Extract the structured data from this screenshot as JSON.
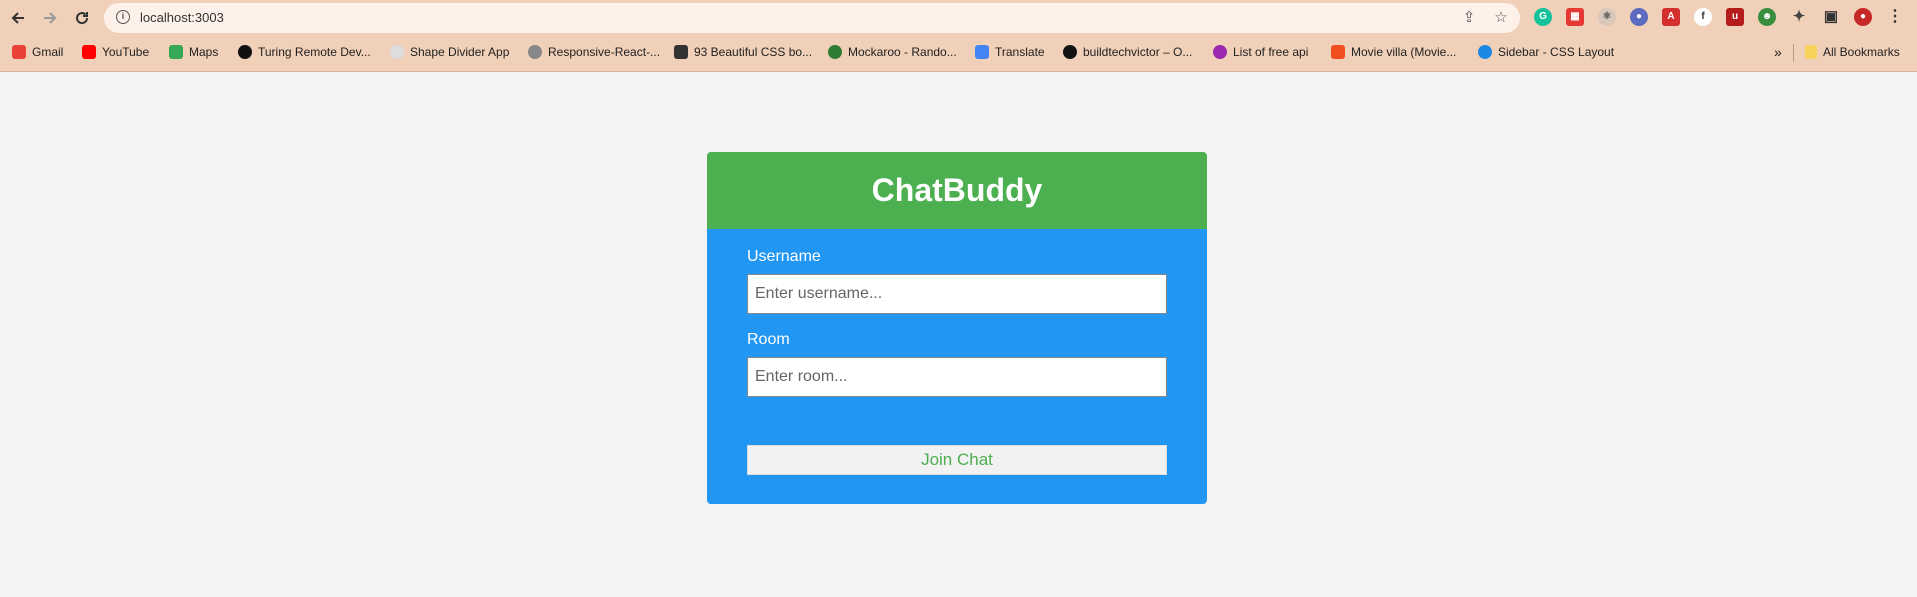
{
  "browser": {
    "url": "localhost:3003",
    "bookmarks": [
      {
        "label": "Gmail",
        "icon": "gmail-icon",
        "color": "#ea4335"
      },
      {
        "label": "YouTube",
        "icon": "youtube-icon",
        "color": "#ff0000"
      },
      {
        "label": "Maps",
        "icon": "maps-icon",
        "color": "#34a853"
      },
      {
        "label": "Turing Remote Dev...",
        "icon": "turing-icon",
        "color": "#111111"
      },
      {
        "label": "Shape Divider App",
        "icon": "shape-divider-icon",
        "color": "#dddddd"
      },
      {
        "label": "Responsive-React-...",
        "icon": "github-icon",
        "color": "#777777"
      },
      {
        "label": "93 Beautiful CSS bo...",
        "icon": "css-box-icon",
        "color": "#333333"
      },
      {
        "label": "Mockaroo - Rando...",
        "icon": "mockaroo-icon",
        "color": "#2e7d32"
      },
      {
        "label": "Translate",
        "icon": "translate-icon",
        "color": "#4285f4"
      },
      {
        "label": "buildtechvictor – O...",
        "icon": "buildtech-icon",
        "color": "#111111"
      },
      {
        "label": "List of free api",
        "icon": "api-list-icon",
        "color": "#9c27b0"
      },
      {
        "label": "Movie villa (Movie...",
        "icon": "figma-icon",
        "color": "#f24e1e"
      },
      {
        "label": "Sidebar - CSS Layout",
        "icon": "sidebar-layout-icon",
        "color": "#1e88e5"
      }
    ],
    "all_bookmarks_label": "All Bookmarks",
    "overflow_label": "»"
  },
  "app": {
    "title": "ChatBuddy",
    "username_label": "Username",
    "username_placeholder": "Enter username...",
    "room_label": "Room",
    "room_placeholder": "Enter room...",
    "join_label": "Join Chat"
  },
  "colors": {
    "header": "#4caf50",
    "body": "#2196f3",
    "page_bg": "#f4f4f4",
    "chrome": "#f0d0b8"
  }
}
